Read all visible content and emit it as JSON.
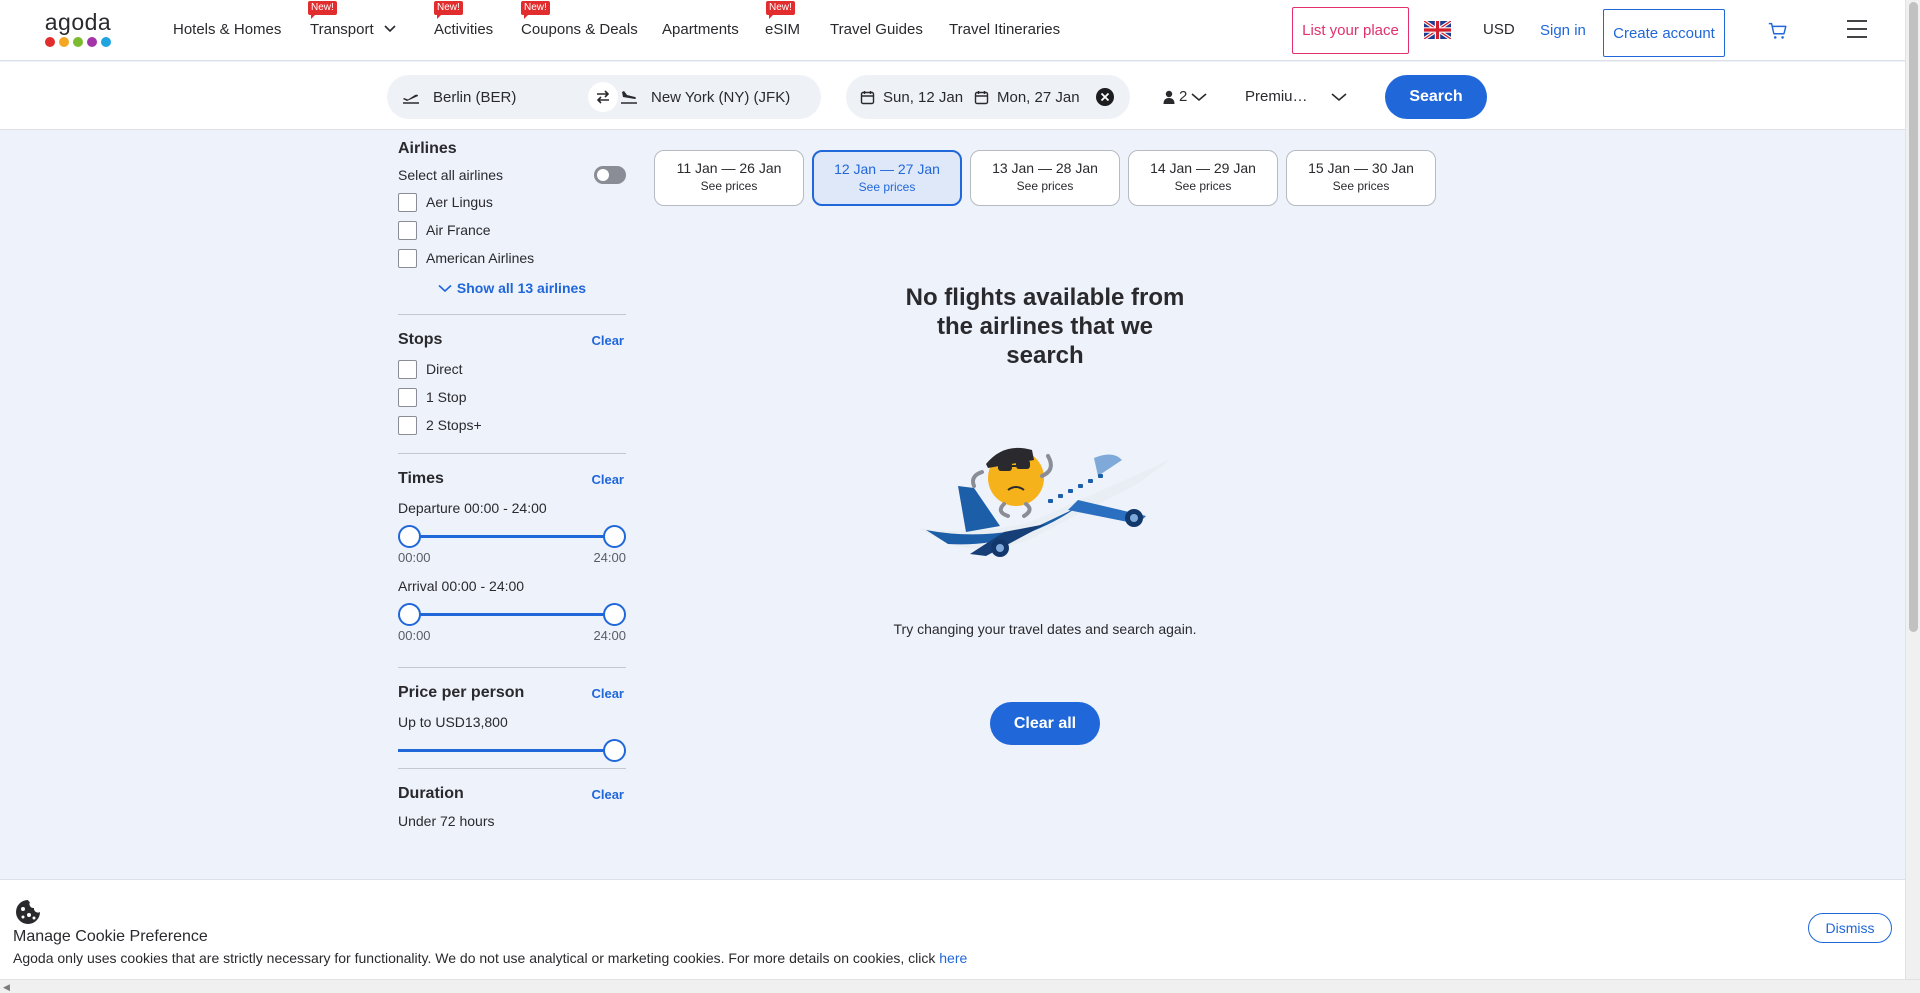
{
  "brand": {
    "name": "agoda",
    "dot_colors": [
      "#e12d2d",
      "#f5a623",
      "#7cbb2f",
      "#a334a8",
      "#1fa4e0"
    ]
  },
  "nav": {
    "items": [
      {
        "label": "Hotels & Homes",
        "badge": ""
      },
      {
        "label": "Transport",
        "badge": "New!"
      },
      {
        "label": "Activities",
        "badge": "New!"
      },
      {
        "label": "Coupons & Deals",
        "badge": "New!"
      },
      {
        "label": "Apartments",
        "badge": ""
      },
      {
        "label": "eSIM",
        "badge": "New!"
      },
      {
        "label": "Travel Guides",
        "badge": ""
      },
      {
        "label": "Travel Itineraries",
        "badge": ""
      }
    ],
    "list_place": "List your place",
    "currency": "USD",
    "sign_in": "Sign in",
    "create_account": "Create account"
  },
  "search": {
    "origin": "Berlin (BER)",
    "destination": "New York (NY) (JFK)",
    "depart_date": "Sun, 12 Jan",
    "return_date": "Mon, 27 Jan",
    "passengers": "2",
    "cabin": "Premium Economy",
    "button": "Search"
  },
  "filters": {
    "airlines": {
      "title": "Airlines",
      "select_all": "Select all airlines",
      "items": [
        "Aer Lingus",
        "Air France",
        "American Airlines"
      ],
      "show_all": "Show all 13 airlines"
    },
    "stops": {
      "title": "Stops",
      "clear": "Clear",
      "items": [
        "Direct",
        "1 Stop",
        "2 Stops+"
      ]
    },
    "times": {
      "title": "Times",
      "clear": "Clear",
      "departure_label": "Departure 00:00 - 24:00",
      "departure_min": "00:00",
      "departure_max": "24:00",
      "arrival_label": "Arrival 00:00 - 24:00",
      "arrival_min": "00:00",
      "arrival_max": "24:00"
    },
    "price": {
      "title": "Price per person",
      "clear": "Clear",
      "label": "Up to USD13,800"
    },
    "duration": {
      "title": "Duration",
      "clear": "Clear",
      "label": "Under 72 hours"
    }
  },
  "date_chips": [
    {
      "range": "11 Jan — 26 Jan",
      "sub": "See prices",
      "active": false
    },
    {
      "range": "12 Jan — 27 Jan",
      "sub": "See prices",
      "active": true
    },
    {
      "range": "13 Jan — 28 Jan",
      "sub": "See prices",
      "active": false
    },
    {
      "range": "14 Jan — 29 Jan",
      "sub": "See prices",
      "active": false
    },
    {
      "range": "15 Jan — 30 Jan",
      "sub": "See prices",
      "active": false
    }
  ],
  "empty_state": {
    "title": "No flights available from the airlines that we search",
    "subtitle": "Try changing your travel dates and search again.",
    "button": "Clear all"
  },
  "cookie": {
    "title": "Manage Cookie Preference",
    "text": "Agoda only uses cookies that are strictly necessary for functionality. We do not use analytical or marketing cookies. For more details on cookies, click ",
    "link": "here",
    "dismiss": "Dismiss"
  },
  "colors": {
    "accent": "#2067da",
    "brand_pink": "#e1306c",
    "badge_red": "#e12d2d",
    "page_bg": "#eef2fa"
  }
}
